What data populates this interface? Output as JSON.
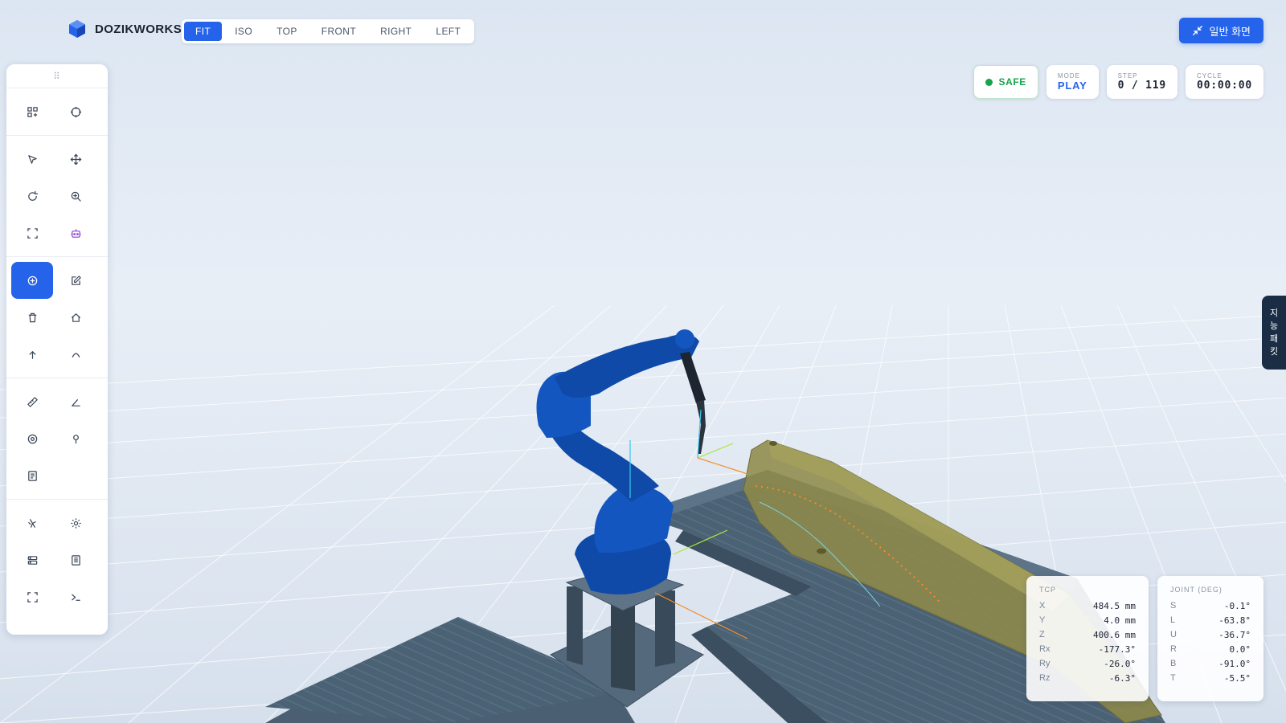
{
  "brand": {
    "name": "DOZIKWORKS"
  },
  "view_tabs": [
    {
      "label": "FIT",
      "active": true
    },
    {
      "label": "ISO",
      "active": false
    },
    {
      "label": "TOP",
      "active": false
    },
    {
      "label": "FRONT",
      "active": false
    },
    {
      "label": "RIGHT",
      "active": false
    },
    {
      "label": "LEFT",
      "active": false
    }
  ],
  "header": {
    "normal_view_label": "일반 화면"
  },
  "status": {
    "safe_label": "SAFE",
    "mode_label": "MODE",
    "mode_value": "PLAY",
    "step_label": "STEP",
    "step_value": "0 / 119",
    "cycle_label": "CYCLE",
    "cycle_value": "00:00:00"
  },
  "side_tab": {
    "chars": [
      "지",
      "능",
      "패",
      "킷"
    ]
  },
  "tcp": {
    "title": "TCP",
    "rows": [
      {
        "k": "X",
        "v": "484.5 mm"
      },
      {
        "k": "Y",
        "v": "4.0 mm"
      },
      {
        "k": "Z",
        "v": "400.6 mm"
      },
      {
        "k": "Rx",
        "v": "-177.3°"
      },
      {
        "k": "Ry",
        "v": "-26.0°"
      },
      {
        "k": "Rz",
        "v": "-6.3°"
      }
    ]
  },
  "joint": {
    "title": "JOINT (DEG)",
    "rows": [
      {
        "k": "S",
        "v": "-0.1°"
      },
      {
        "k": "L",
        "v": "-63.8°"
      },
      {
        "k": "U",
        "v": "-36.7°"
      },
      {
        "k": "R",
        "v": "0.0°"
      },
      {
        "k": "B",
        "v": "-91.0°"
      },
      {
        "k": "T",
        "v": "-5.5°"
      }
    ]
  },
  "colors": {
    "accent": "#2563eb",
    "safe": "#16a34a",
    "robot": "#0f4aa8",
    "workpiece": "#8e8a4a",
    "table": "#4d6478",
    "side_tab": "#1b2d44"
  }
}
